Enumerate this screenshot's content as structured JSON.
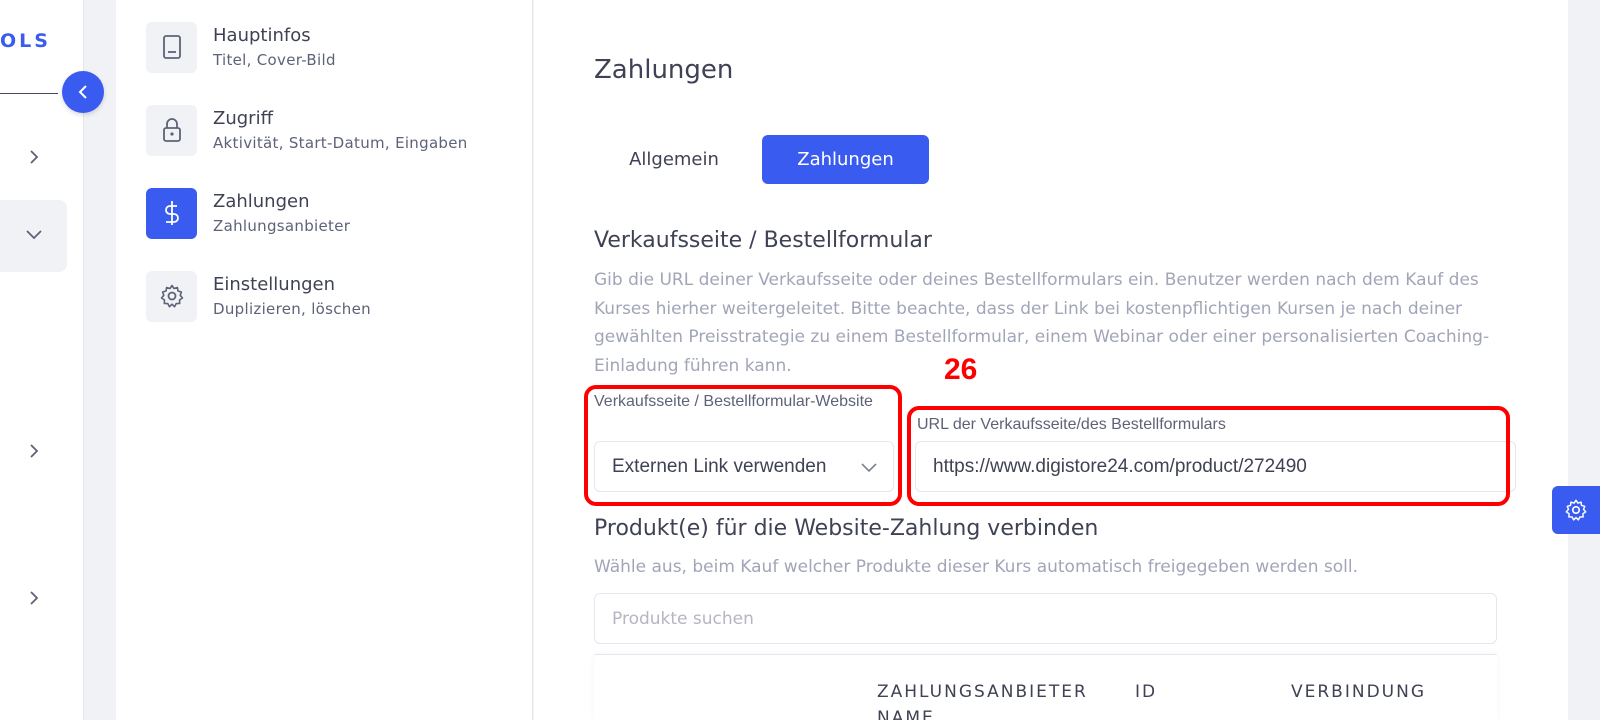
{
  "app": {
    "brand_fragment": "OLS",
    "accent_color": "#3a5bf0"
  },
  "course_nav": {
    "items": [
      {
        "title": "Hauptinfos",
        "subtitle": "Titel, Cover-Bild",
        "icon": "book-icon"
      },
      {
        "title": "Zugriff",
        "subtitle": "Aktivität, Start-Datum, Eingaben",
        "icon": "lock-icon"
      },
      {
        "title": "Zahlungen",
        "subtitle": "Zahlungsanbieter",
        "icon": "dollar-icon",
        "active": true
      },
      {
        "title": "Einstellungen",
        "subtitle": "Duplizieren, löschen",
        "icon": "gear-icon"
      }
    ]
  },
  "main": {
    "title": "Zahlungen",
    "tabs": [
      {
        "label": "Allgemein",
        "active": false
      },
      {
        "label": "Zahlungen",
        "active": true
      }
    ],
    "sales_page": {
      "title": "Verkaufsseite / Bestellformular",
      "description": "Gib die URL deiner Verkaufsseite oder deines Bestellformulars ein. Benutzer werden nach dem Kauf des Kurses hierher weitergeleitet. Bitte beachte, dass der Link bei kostenpflichtigen Kursen je nach deiner gewählten Preisstrategie zu einem Bestellformular, einem Webinar oder einer personalisierten Coaching-Einladung führen kann.",
      "select_label": "Verkaufsseite / Bestellformular-Website",
      "select_value": "Externen Link verwenden",
      "url_label": "URL der Verkaufsseite/des Bestellformulars",
      "url_value": "https://www.digistore24.com/product/272490"
    },
    "products": {
      "title": "Produkt(e) für die Website-Zahlung verbinden",
      "description": "Wähle aus, beim Kauf welcher Produkte dieser Kurs automatisch freigegeben werden soll.",
      "search_placeholder": "Produkte suchen",
      "table_headers": [
        "ZAHLUNGSANBIETER NAME",
        "ID",
        "VERBINDUNG"
      ]
    }
  },
  "annotation": {
    "step_number": "26",
    "color": "#ff0000"
  }
}
